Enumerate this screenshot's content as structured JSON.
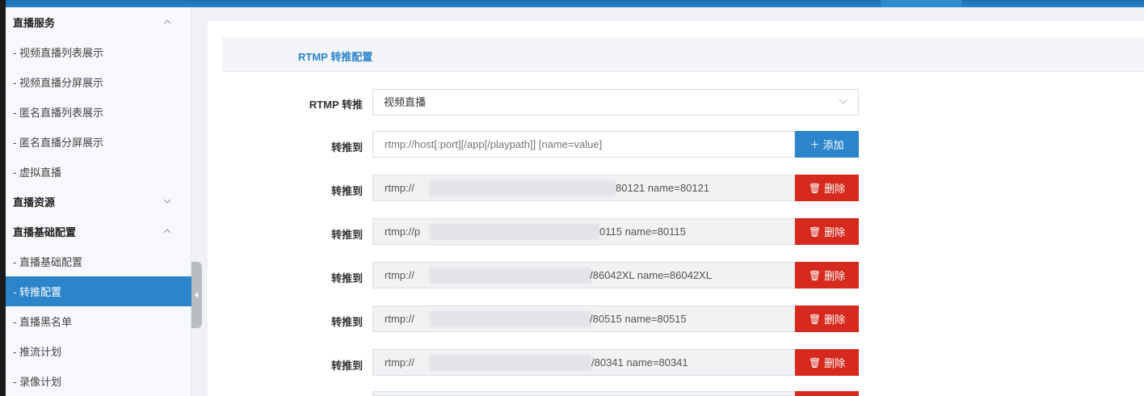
{
  "sidebar": {
    "items": [
      {
        "label": "直播服务",
        "type": "group",
        "expanded": true
      },
      {
        "label": "- 视频直播列表展示",
        "type": "item"
      },
      {
        "label": "- 视频直播分屏展示",
        "type": "item"
      },
      {
        "label": "- 匿名直播列表展示",
        "type": "item"
      },
      {
        "label": "- 匿名直播分屏展示",
        "type": "item"
      },
      {
        "label": "- 虚拟直播",
        "type": "item"
      },
      {
        "label": "直播资源",
        "type": "group",
        "expanded": false
      },
      {
        "label": "直播基础配置",
        "type": "group",
        "expanded": true
      },
      {
        "label": "- 直播基础配置",
        "type": "item"
      },
      {
        "label": "- 转推配置",
        "type": "item",
        "active": true
      },
      {
        "label": "- 直播黑名单",
        "type": "item"
      },
      {
        "label": "- 推流计划",
        "type": "item"
      },
      {
        "label": "- 录像计划",
        "type": "item"
      }
    ]
  },
  "panel": {
    "title": "RTMP 转推配置",
    "rtmp_label": "RTMP 转推",
    "rtmp_value": "视频直播",
    "push_label": "转推到",
    "push_placeholder": "rtmp://host[:port][/app[/playpath]] [name=value]",
    "add_label": "添加",
    "delete_label": "删除",
    "entries": [
      {
        "prefix": "rtmp://",
        "suffix": "80121 name=80121"
      },
      {
        "prefix": "rtmp://p",
        "suffix": "0115 name=80115"
      },
      {
        "prefix": "rtmp://",
        "suffix": "/86042XL name=86042XL"
      },
      {
        "prefix": "rtmp://",
        "suffix": "/80515 name=80515"
      },
      {
        "prefix": "rtmp://",
        "suffix": "/80341 name=80341"
      }
    ]
  },
  "colors": {
    "accent": "#2c84cb",
    "danger": "#d62a1e"
  },
  "icons": {
    "add": "plus-icon",
    "delete": "trash-icon",
    "chevron_up": "chevron-up-icon",
    "chevron_down": "chevron-down-icon"
  }
}
